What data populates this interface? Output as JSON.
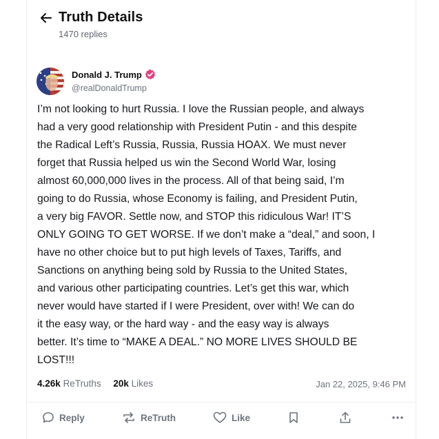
{
  "header": {
    "title": "Truth Details",
    "reply_count": "1470 replies"
  },
  "post": {
    "author_name": "Donald J. Trump",
    "author_handle": "@realDonaldTrump",
    "body": "I’m not looking to hurt Russia. I love the Russian people, and always\nhad a very good relationship with President Putin - and this despite\nthe Radical Left’s Russia, Russia, Russia HOAX. We must never\nforget that Russia helped us win the Second World War, losing\nalmost 60,000,000 lives in the process. All of that being said, I’m\ngoing to do Russia, whose Economy is failing, and President Putin,\na very big FAVOR. Settle now, and STOP this ridiculous War! IT’S\nONLY GOING TO GET WORSE. If we don’t make a “deal,” and soon, I\nhave no other choice but to put high levels of Taxes, Tariffs, and\nSanctions on anything being sold by Russia to the United States,\nand various other participating countries. Let’s get this war, which\nnever would have started if I were President, over with! We can do\nit the easy way, or the hard way - and the easy way is always\nbetter. It’s time to “MAKE A DEAL.” NO MORE LIVES SHOULD BE\nLOST!!!",
    "retruths_count": "4.26k",
    "retruths_label": "ReTruths",
    "likes_count": "20k",
    "likes_label": "Likes",
    "timestamp": "Jan 22, 2025, 9:46 PM"
  },
  "actions": {
    "reply_label": "Reply",
    "retruth_label": "ReTruth",
    "like_label": "Like"
  },
  "icons": {
    "back": "arrow-left-icon",
    "verified": "verified-badge-icon",
    "reply": "speech-bubble-icon",
    "retruth": "repost-arrows-icon",
    "like": "heart-icon",
    "bookmark": "bookmark-icon",
    "share": "share-upload-icon",
    "more": "ellipsis-icon"
  },
  "colors": {
    "verified_badge": "#e3407c",
    "muted_text": "#6c737d"
  }
}
